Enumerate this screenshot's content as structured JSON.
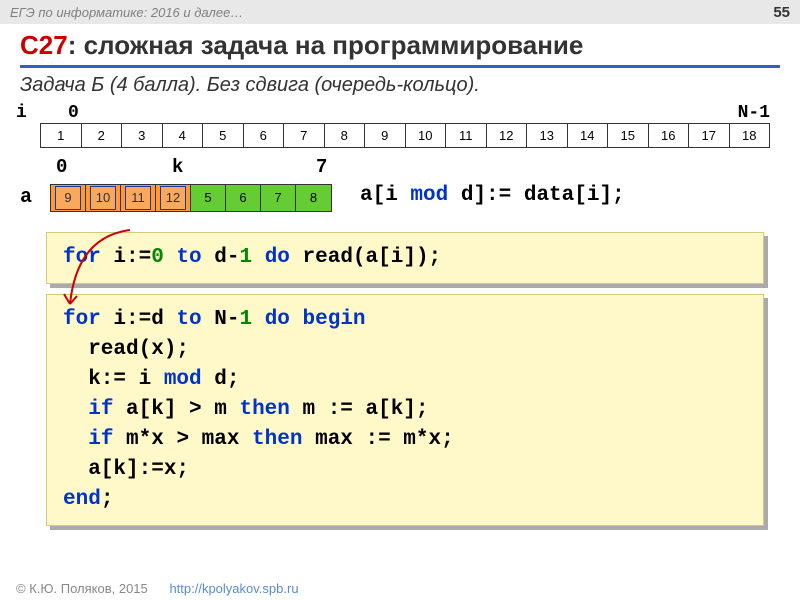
{
  "topbar": {
    "left": "ЕГЭ по информатике: 2016 и далее…",
    "page": "55"
  },
  "title": {
    "prefix": "C27",
    "rest": ": сложная задача на программирование"
  },
  "subtitle": "Задача Б (4 балла). Без сдвига (очередь-кольцо).",
  "strip": {
    "i_label": "i",
    "zero": "0",
    "right": "N-1",
    "cells": [
      "1",
      "2",
      "3",
      "4",
      "5",
      "6",
      "7",
      "8",
      "9",
      "10",
      "11",
      "12",
      "13",
      "14",
      "15",
      "16",
      "17",
      "18"
    ]
  },
  "arow": {
    "label_a": "a",
    "top_zero": "0",
    "top_k": "k",
    "top_seven": "7",
    "cells": [
      {
        "v": "9",
        "cls": "orange"
      },
      {
        "v": "10",
        "cls": "orange"
      },
      {
        "v": "11",
        "cls": "orange"
      },
      {
        "v": "12",
        "cls": "orange"
      },
      {
        "v": "5",
        "cls": "green"
      },
      {
        "v": "6",
        "cls": "green"
      },
      {
        "v": "7",
        "cls": "green"
      },
      {
        "v": "8",
        "cls": "green"
      }
    ],
    "assign_lhs": "a[i ",
    "assign_mod": "mod",
    "assign_mid": " d]:= data[i];"
  },
  "code1": {
    "t1": "for",
    "t2": " i:=",
    "n0": "0",
    "t3": " ",
    "kw_to": "to",
    "t4": " d-",
    "n1": "1",
    "t5": " ",
    "kw_do": "do",
    "t6": " read(a[i]);"
  },
  "code2": {
    "l1a": "for",
    "l1b": " i:=d ",
    "l1c": "to",
    "l1d": " N-",
    "l1e": "1",
    "l1f": " ",
    "l1g": "do",
    "l1h": " ",
    "l1i": "begin",
    "l2": "  read(x);",
    "l3a": "  k:= i ",
    "l3b": "mod",
    "l3c": " d;",
    "l4a": "  ",
    "l4b": "if",
    "l4c": " a[k] > m ",
    "l4d": "then",
    "l4e": " m := a[k];",
    "l5a": "  ",
    "l5b": "if",
    "l5c": " m*x > max ",
    "l5d": "then",
    "l5e": " max := m*x;",
    "l6": "  a[k]:=x;",
    "l7": "end",
    "l7b": ";"
  },
  "footer": {
    "copy": "© К.Ю. Поляков, 2015",
    "url": "http://kpolyakov.spb.ru"
  }
}
